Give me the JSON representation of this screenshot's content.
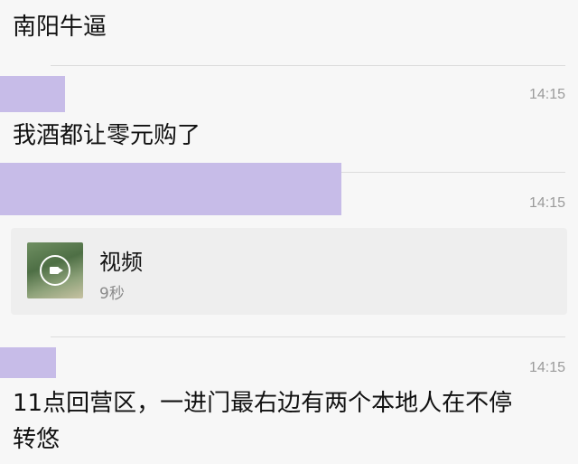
{
  "messages": [
    {
      "text": "南阳牛逼"
    },
    {
      "time": "14:15",
      "text": "我酒都让零元购了"
    },
    {
      "time": "14:15",
      "video": {
        "label": "视频",
        "duration": "9秒"
      }
    },
    {
      "time": "14:15",
      "text": "11点回营区，一进门最右边有两个本地人在不停",
      "text_cont": "转悠"
    }
  ],
  "icons": {
    "video_play": "video-camera-icon"
  },
  "colors": {
    "redaction": "#c7bce8",
    "background": "#f7f7f7",
    "card": "#eeeeee",
    "time": "#9b9b9b"
  }
}
